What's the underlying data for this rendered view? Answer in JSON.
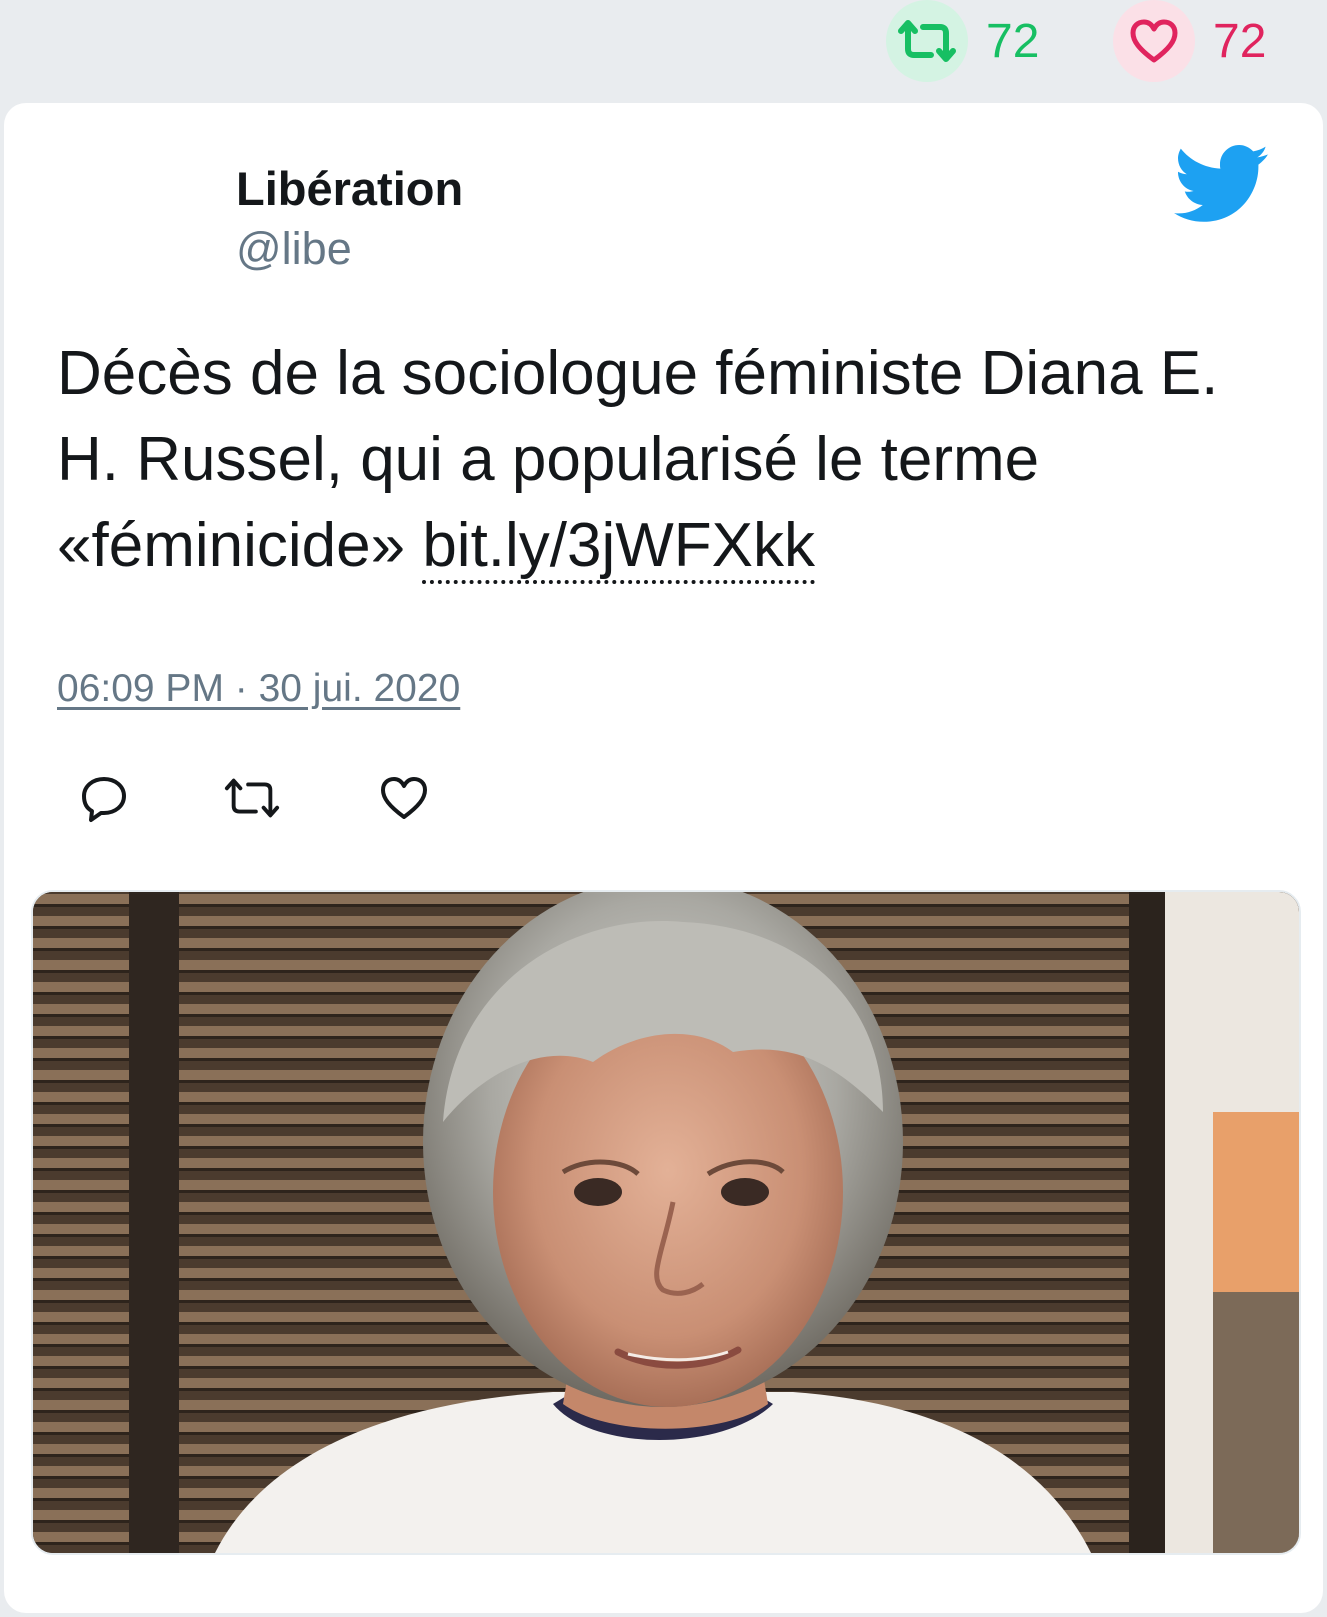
{
  "top_stats": {
    "retweet_count": "72",
    "like_count": "72"
  },
  "tweet": {
    "author_name": "Libération",
    "author_handle": "@libe",
    "text": "Décès de la sociologue féministe Diana E. H. Russel, qui a popularisé le terme «féminicide» ",
    "link": "bit.ly/3jWFXkk",
    "timestamp": "06:09 PM · 30 jui. 2020"
  },
  "icons": {
    "retweet": "retweet-icon",
    "like": "heart-icon",
    "reply": "reply-icon",
    "brand": "twitter-bird-icon"
  },
  "colors": {
    "retweet": "#17bf63",
    "like": "#e0245e",
    "brand": "#1da1f2",
    "secondary_text": "#657786"
  }
}
